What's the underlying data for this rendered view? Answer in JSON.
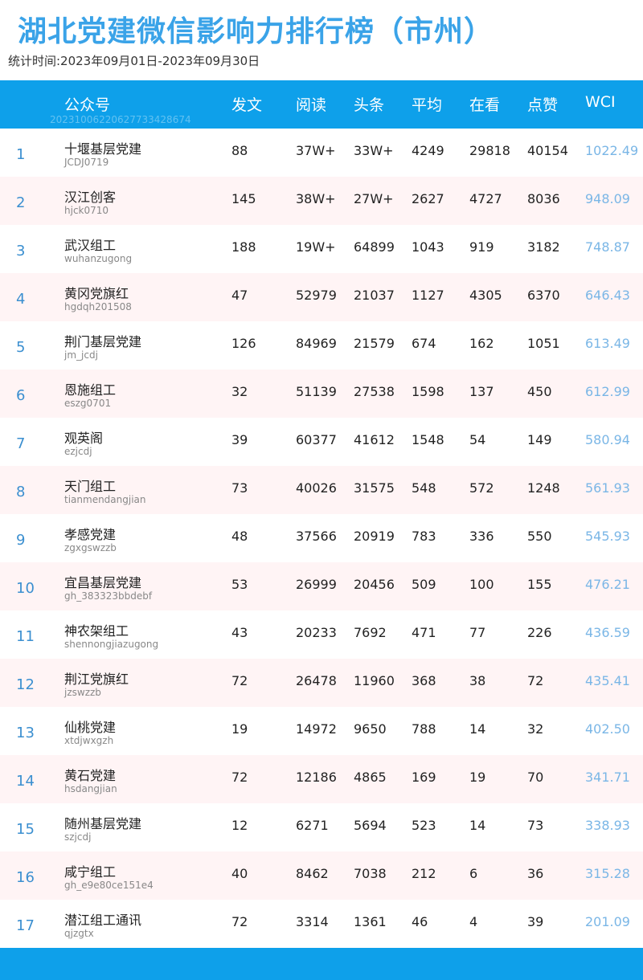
{
  "title": "湖北党建微信影响力排行榜（市州）",
  "period": "统计时间:2023年09月01日-2023年09月30日",
  "header": {
    "account": "公众号",
    "watermark": "20231006220627733428674",
    "posts": "发文",
    "reads": "阅读",
    "headline": "头条",
    "average": "平均",
    "watching": "在看",
    "likes": "点赞",
    "wci": "WCI"
  },
  "rows": [
    {
      "rank": "1",
      "name": "十堰基层党建",
      "account": "JCDJ0719",
      "posts": "88",
      "reads": "37W+",
      "headline": "33W+",
      "average": "4249",
      "watching": "29818",
      "likes": "40154",
      "wci": "1022.49"
    },
    {
      "rank": "2",
      "name": "汉江创客",
      "account": "hjck0710",
      "posts": "145",
      "reads": "38W+",
      "headline": "27W+",
      "average": "2627",
      "watching": "4727",
      "likes": "8036",
      "wci": "948.09"
    },
    {
      "rank": "3",
      "name": "武汉组工",
      "account": "wuhanzugong",
      "posts": "188",
      "reads": "19W+",
      "headline": "64899",
      "average": "1043",
      "watching": "919",
      "likes": "3182",
      "wci": "748.87"
    },
    {
      "rank": "4",
      "name": "黄冈党旗红",
      "account": "hgdqh201508",
      "posts": "47",
      "reads": "52979",
      "headline": "21037",
      "average": "1127",
      "watching": "4305",
      "likes": "6370",
      "wci": "646.43"
    },
    {
      "rank": "5",
      "name": "荆门基层党建",
      "account": "jm_jcdj",
      "posts": "126",
      "reads": "84969",
      "headline": "21579",
      "average": "674",
      "watching": "162",
      "likes": "1051",
      "wci": "613.49"
    },
    {
      "rank": "6",
      "name": "恩施组工",
      "account": "eszg0701",
      "posts": "32",
      "reads": "51139",
      "headline": "27538",
      "average": "1598",
      "watching": "137",
      "likes": "450",
      "wci": "612.99"
    },
    {
      "rank": "7",
      "name": "观英阁",
      "account": "ezjcdj",
      "posts": "39",
      "reads": "60377",
      "headline": "41612",
      "average": "1548",
      "watching": "54",
      "likes": "149",
      "wci": "580.94"
    },
    {
      "rank": "8",
      "name": "天门组工",
      "account": "tianmendangjian",
      "posts": "73",
      "reads": "40026",
      "headline": "31575",
      "average": "548",
      "watching": "572",
      "likes": "1248",
      "wci": "561.93"
    },
    {
      "rank": "9",
      "name": "孝感党建",
      "account": "zgxgswzzb",
      "posts": "48",
      "reads": "37566",
      "headline": "20919",
      "average": "783",
      "watching": "336",
      "likes": "550",
      "wci": "545.93"
    },
    {
      "rank": "10",
      "name": "宜昌基层党建",
      "account": "gh_383323bbdebf",
      "posts": "53",
      "reads": "26999",
      "headline": "20456",
      "average": "509",
      "watching": "100",
      "likes": "155",
      "wci": "476.21"
    },
    {
      "rank": "11",
      "name": "神农架组工",
      "account": "shennongjiazugong",
      "posts": "43",
      "reads": "20233",
      "headline": "7692",
      "average": "471",
      "watching": "77",
      "likes": "226",
      "wci": "436.59"
    },
    {
      "rank": "12",
      "name": "荆江党旗红",
      "account": "jzswzzb",
      "posts": "72",
      "reads": "26478",
      "headline": "11960",
      "average": "368",
      "watching": "38",
      "likes": "72",
      "wci": "435.41"
    },
    {
      "rank": "13",
      "name": "仙桃党建",
      "account": "xtdjwxgzh",
      "posts": "19",
      "reads": "14972",
      "headline": "9650",
      "average": "788",
      "watching": "14",
      "likes": "32",
      "wci": "402.50"
    },
    {
      "rank": "14",
      "name": "黄石党建",
      "account": "hsdangjian",
      "posts": "72",
      "reads": "12186",
      "headline": "4865",
      "average": "169",
      "watching": "19",
      "likes": "70",
      "wci": "341.71"
    },
    {
      "rank": "15",
      "name": "随州基层党建",
      "account": "szjcdj",
      "posts": "12",
      "reads": "6271",
      "headline": "5694",
      "average": "523",
      "watching": "14",
      "likes": "73",
      "wci": "338.93"
    },
    {
      "rank": "16",
      "name": "咸宁组工",
      "account": "gh_e9e80ce151e4",
      "posts": "40",
      "reads": "8462",
      "headline": "7038",
      "average": "212",
      "watching": "6",
      "likes": "36",
      "wci": "315.28"
    },
    {
      "rank": "17",
      "name": "潜江组工通讯",
      "account": "qjzgtx",
      "posts": "72",
      "reads": "3314",
      "headline": "1361",
      "average": "46",
      "watching": "4",
      "likes": "39",
      "wci": "201.09"
    }
  ]
}
